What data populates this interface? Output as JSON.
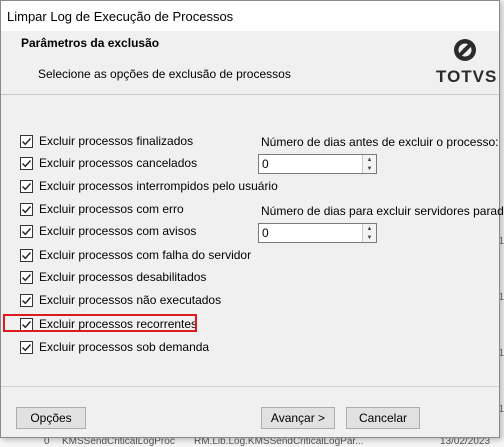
{
  "window": {
    "title": "Limpar Log de Execução de Processos"
  },
  "header": {
    "title": "Parâmetros da exclusão",
    "subtitle": "Selecione as opções de exclusão de processos",
    "logo_text": "TOTVS"
  },
  "options": [
    {
      "label": "Excluir processos finalizados",
      "checked": true
    },
    {
      "label": "Excluir processos cancelados",
      "checked": true
    },
    {
      "label": "Excluir processos interrompidos pelo usuário",
      "checked": true
    },
    {
      "label": "Excluir processos com erro",
      "checked": true
    },
    {
      "label": "Excluir processos com avisos",
      "checked": true
    },
    {
      "label": "Excluir processos com falha do servidor",
      "checked": true
    },
    {
      "label": "Excluir processos desabilitados",
      "checked": true
    },
    {
      "label": "Excluir processos não executados",
      "checked": true
    },
    {
      "label": "Excluir processos recorrentes",
      "checked": true,
      "highlighted": true
    },
    {
      "label": "Excluir processos sob demanda",
      "checked": true
    }
  ],
  "fields": {
    "days_before_delete_process": {
      "label": "Número de dias antes de excluir o processo:",
      "value": "0"
    },
    "days_delete_stopped_servers": {
      "label": "Número de dias para excluir servidores parados:",
      "value": "0"
    }
  },
  "buttons": {
    "options": "Opções",
    "next": "Avançar >",
    "cancel": "Cancelar"
  },
  "background": {
    "right_strip_texts": [
      "1",
      "1",
      "1",
      "1"
    ],
    "bottom_row_texts": [
      "0",
      "KMSSendCriticalLogProc",
      "RM.Lib.Log.KMSSendCriticalLogPar...",
      "13/02/2023"
    ]
  },
  "colors": {
    "highlight": "#e0191e",
    "dialog_bg": "#f0f0f0"
  }
}
